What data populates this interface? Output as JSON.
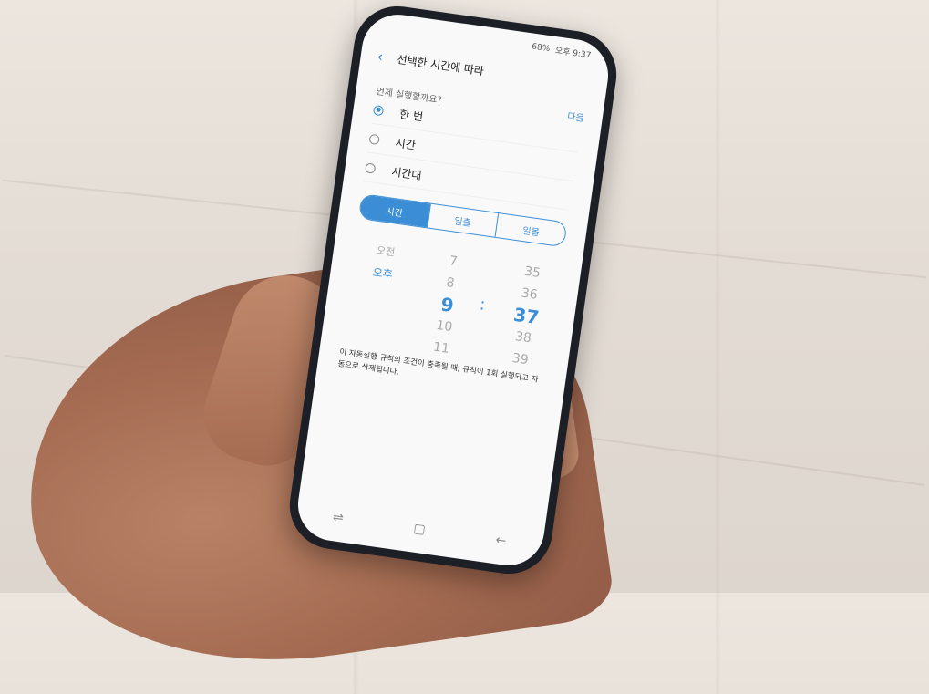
{
  "status_bar": {
    "battery": "68%",
    "time": "오후 9:37"
  },
  "header": {
    "title": "선택한 시간에 따라"
  },
  "question": "언제 실행할까요?",
  "next_label": "다음",
  "options": [
    {
      "label": "한 번",
      "selected": true
    },
    {
      "label": "시간",
      "selected": false
    },
    {
      "label": "시간대",
      "selected": false
    }
  ],
  "segments": [
    "시간",
    "일출",
    "일몰"
  ],
  "picker": {
    "ampm": [
      "오전",
      "오후"
    ],
    "hours": [
      "7",
      "8",
      "9",
      "10",
      "11"
    ],
    "minutes": [
      "35",
      "36",
      "37",
      "38",
      "39"
    ],
    "colon": ":"
  },
  "note": "이 자동실행 규칙의 조건이 충족될 때, 규칙이 1회 실행되고 자동으로 삭제됩니다.",
  "colors": {
    "accent": "#3b8ed6",
    "phone_body": "#1c1f26",
    "screen_bg": "#f9f9f9"
  },
  "icons": [
    "back-arrow-icon",
    "recent-apps-icon",
    "home-icon",
    "back-icon"
  ]
}
